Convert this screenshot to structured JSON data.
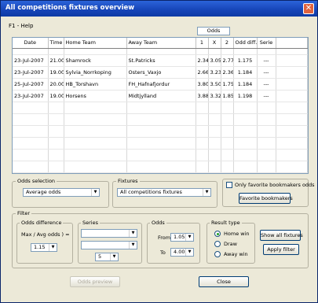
{
  "window": {
    "title": "All competitions fixtures overview",
    "close_glyph": "✕"
  },
  "menu": {
    "help": "F1 - Help"
  },
  "odds_header": "Odds",
  "grid": {
    "columns": [
      "Date",
      "Time",
      "Home Team",
      "Away Team",
      "1",
      "X",
      "2",
      "Odd diff.",
      "Serie"
    ],
    "rows": [
      [
        "23-Jul-2007",
        "21.00",
        "Shamrock",
        "St.Patricks",
        "2.34",
        "3.05",
        "2.77",
        "1.175",
        "---"
      ],
      [
        "23-Jul-2007",
        "19.00",
        "Sylvia_Norrkoping",
        "Osters_Vaxjo",
        "2.66",
        "3.23",
        "2.36",
        "1.184",
        "---"
      ],
      [
        "25-Jul-2007",
        "20.00",
        "HB_Torshavn",
        "FH_Hafnafjordur",
        "3.80",
        "3.50",
        "1.75",
        "1.184",
        "---"
      ],
      [
        "23-Jul-2007",
        "19.00",
        "Horsens",
        "Midtjylland",
        "3.88",
        "3.32",
        "1.85",
        "1.198",
        "---"
      ]
    ]
  },
  "odds_selection": {
    "label": "Odds selection",
    "value": "Average odds"
  },
  "fixtures": {
    "label": "Fixtures",
    "value": "All competitions fixtures"
  },
  "favorites": {
    "checkbox_label": "Only favorite bookmakers odds",
    "button": "Favorite bookmakers"
  },
  "filter": {
    "label": "Filter",
    "odds_difference": {
      "label": "Odds difference",
      "caption": "Max / Avg odds ) =",
      "value": "1.15"
    },
    "series": {
      "label": "Series",
      "value1": "",
      "value2": "",
      "count": "5"
    },
    "odds": {
      "label": "Odds",
      "from_label": "From",
      "from_value": "1.05",
      "to_label": "To",
      "to_value": "4.00"
    },
    "result_type": {
      "label": "Result type",
      "options": [
        "Home win",
        "Draw",
        "Away win"
      ],
      "selected": "Home win"
    },
    "show_all_button": "Show all fixtures",
    "apply_button": "Apply filter"
  },
  "buttons": {
    "odds_preview": "Odds preview",
    "close": "Close"
  }
}
